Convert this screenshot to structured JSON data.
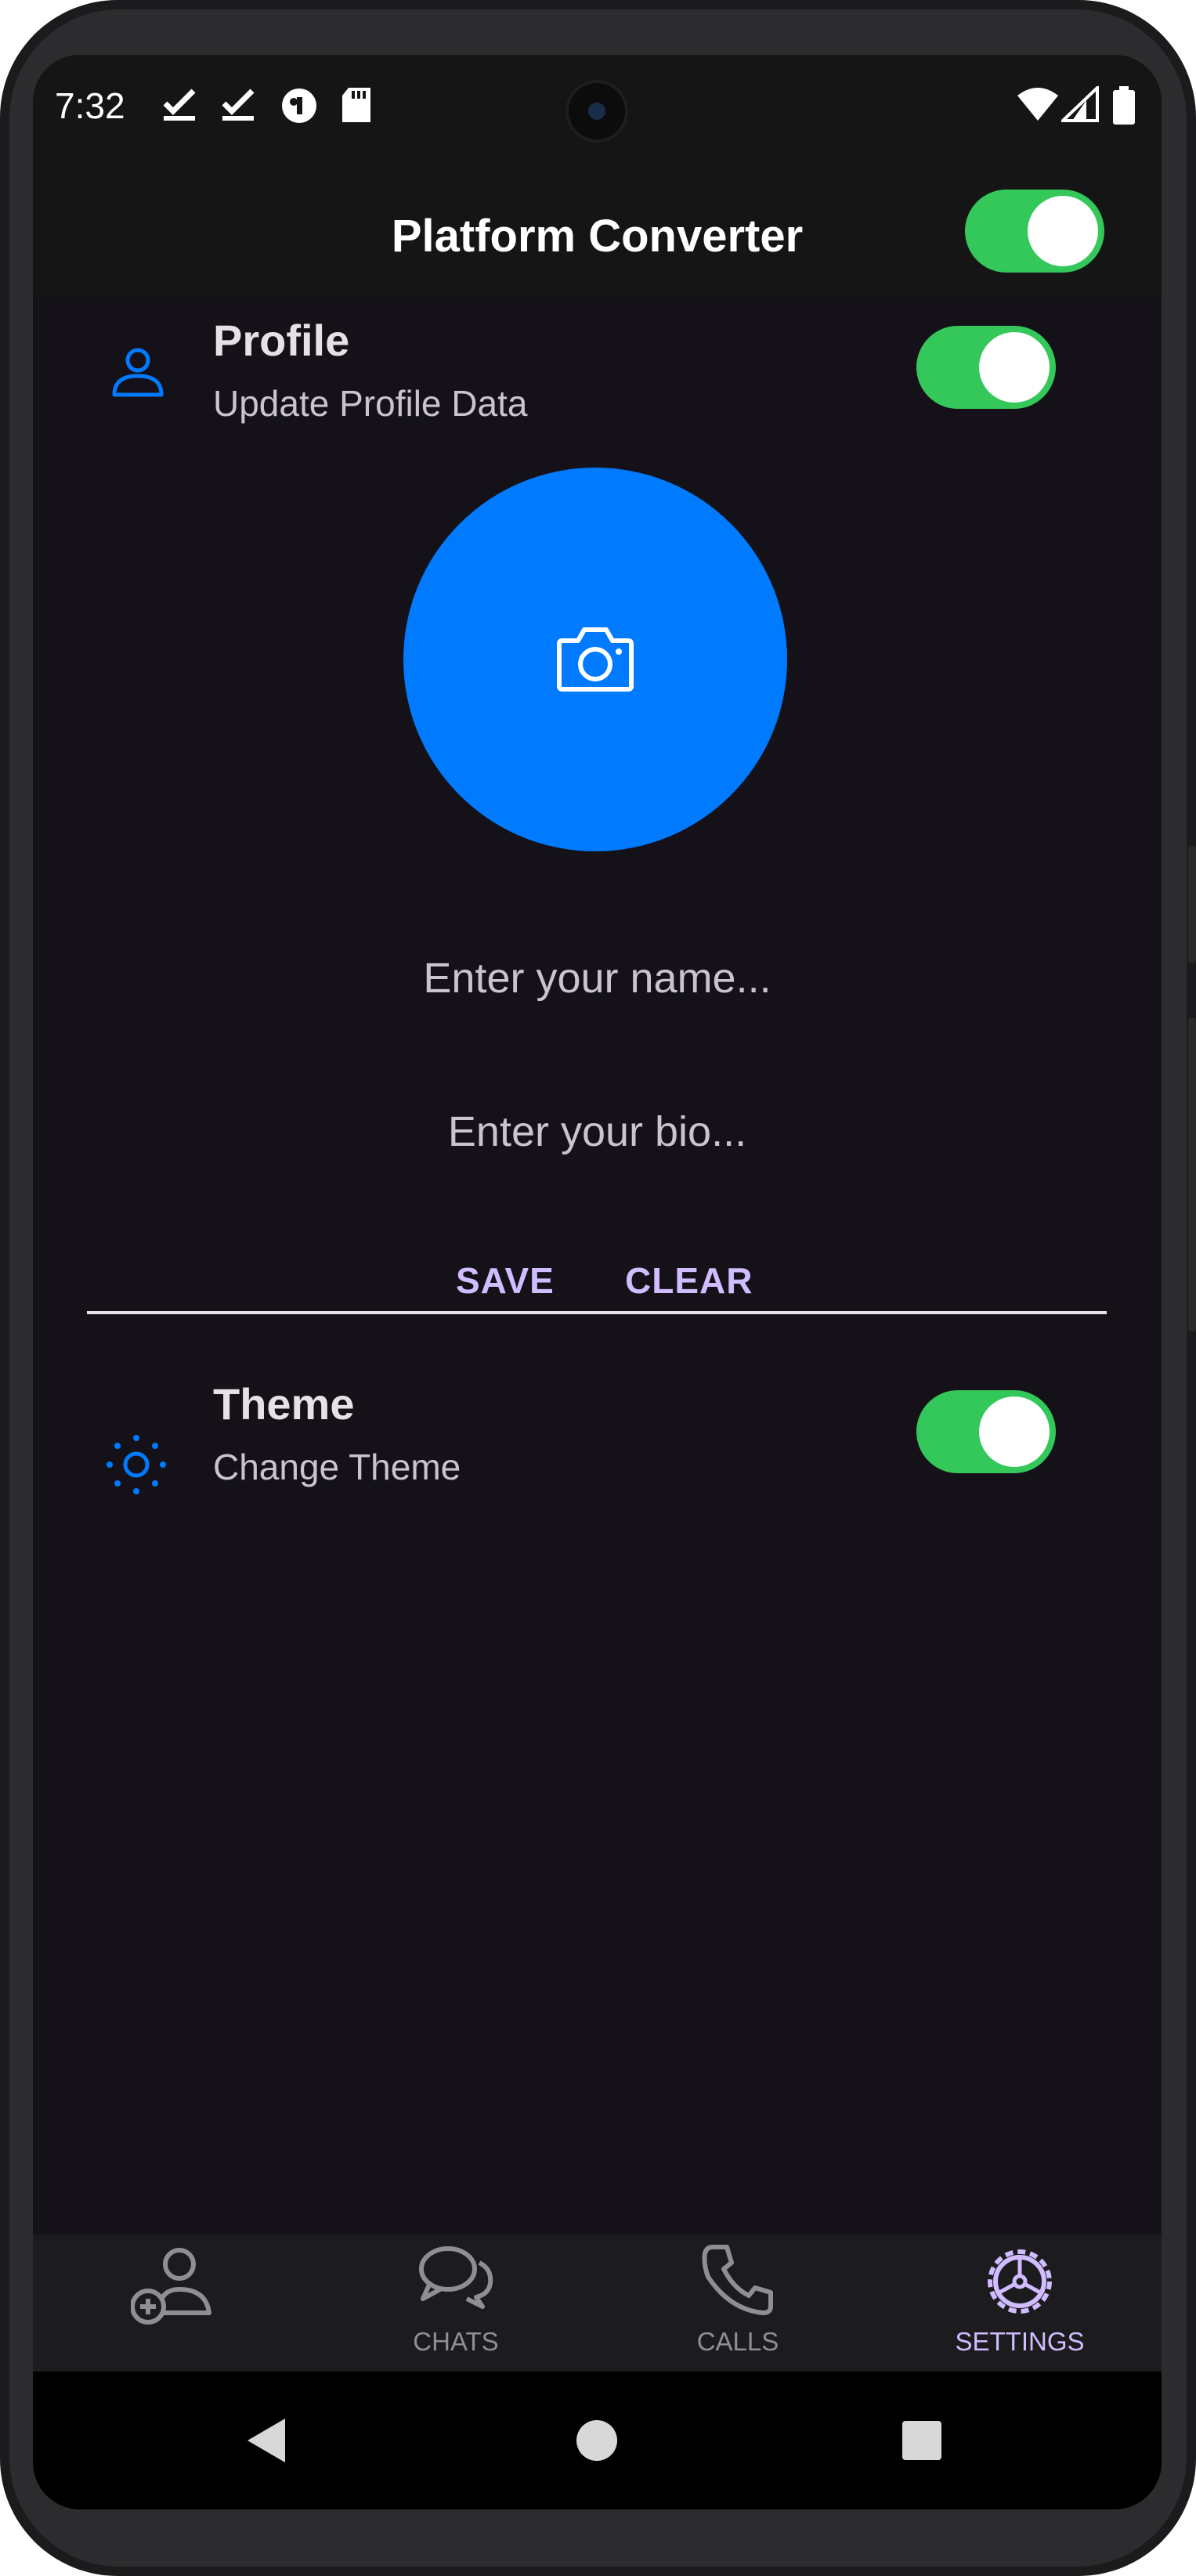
{
  "status_bar": {
    "time": "7:32"
  },
  "app_bar": {
    "title": "Platform Converter",
    "platform_toggle_on": true
  },
  "profile_section": {
    "title": "Profile",
    "subtitle": "Update Profile Data",
    "icon": "person-outline-icon",
    "toggle_on": true,
    "avatar_icon": "camera-icon",
    "name_placeholder": "Enter your name...",
    "bio_placeholder": "Enter your bio...",
    "save_label": "SAVE",
    "clear_label": "CLEAR"
  },
  "theme_section": {
    "title": "Theme",
    "subtitle": "Change Theme",
    "icon": "sun-icon",
    "toggle_on": true
  },
  "bottom_nav": {
    "items": [
      {
        "label": "",
        "icon": "add-person-icon",
        "active": false
      },
      {
        "label": "CHATS",
        "icon": "chat-bubbles-icon",
        "active": false
      },
      {
        "label": "CALLS",
        "icon": "phone-icon",
        "active": false
      },
      {
        "label": "SETTINGS",
        "icon": "settings-gear-icon",
        "active": true
      }
    ]
  },
  "colors": {
    "accent_blue": "#007aff",
    "toggle_green": "#34c759",
    "button_purple": "#d0bcff",
    "background": "#141218"
  }
}
